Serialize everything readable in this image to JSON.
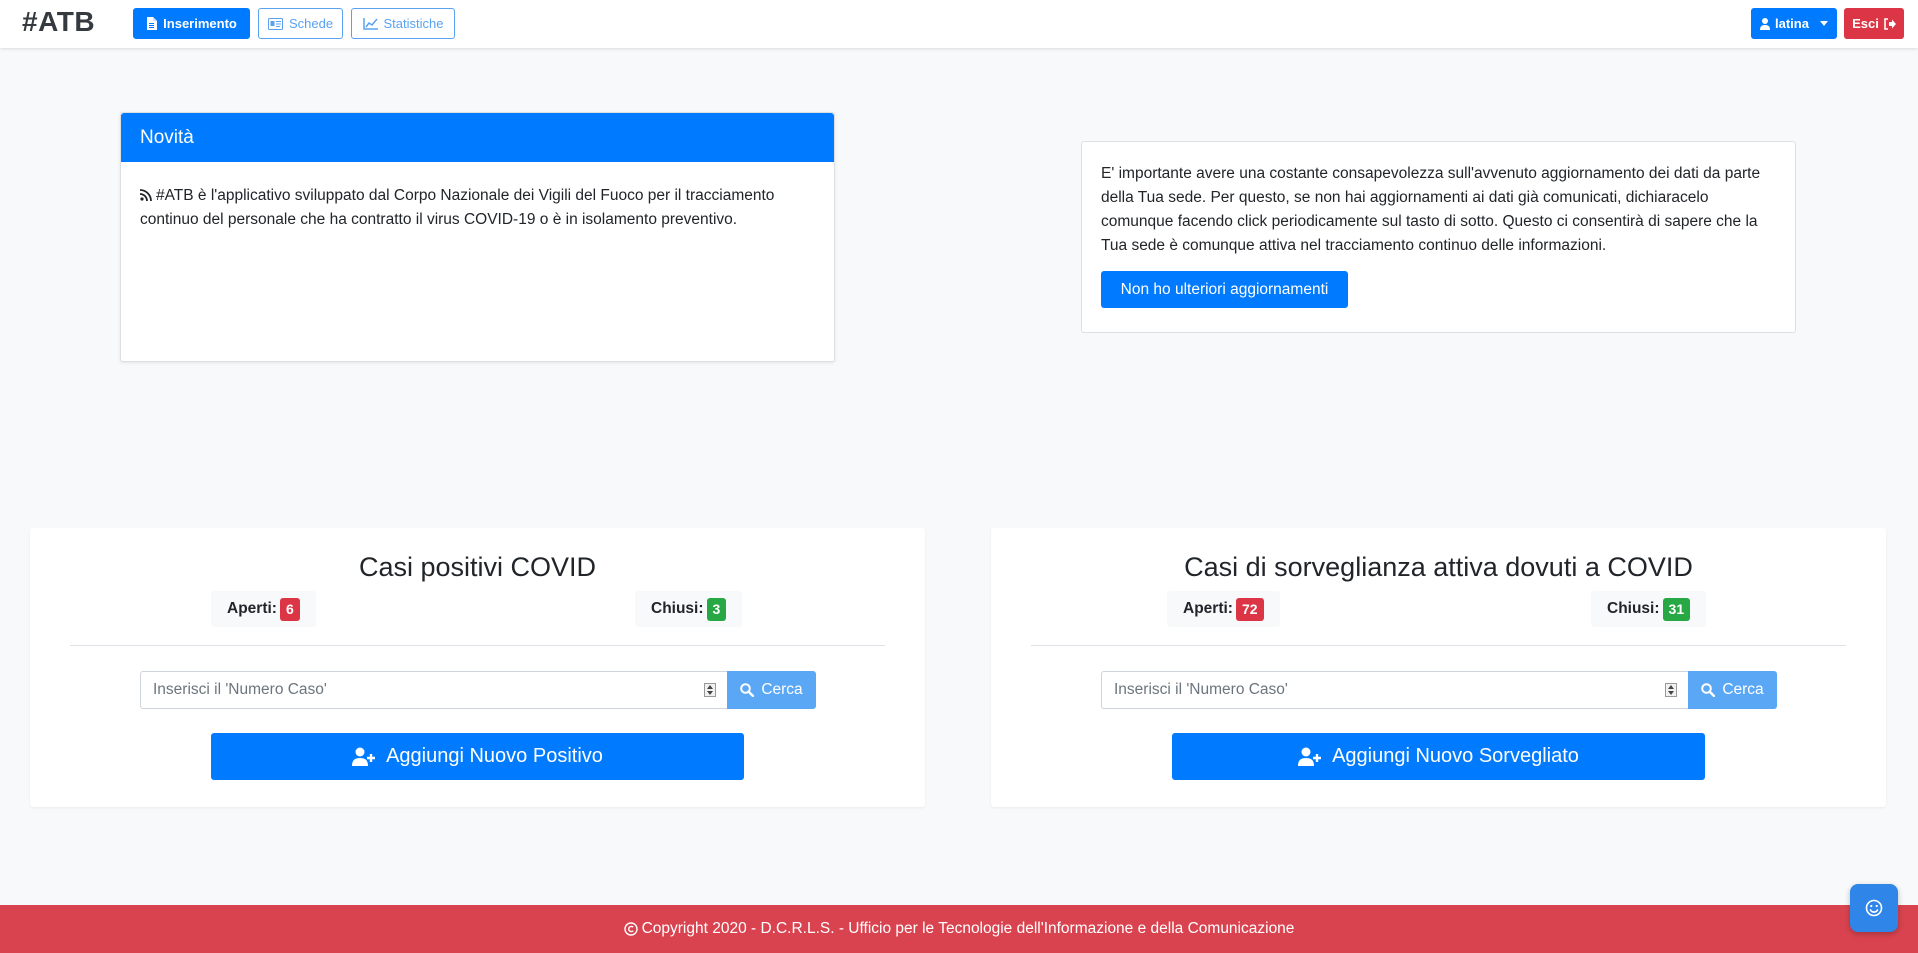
{
  "brand": "#ATB",
  "nav": {
    "tabs": [
      {
        "label": "Inserimento"
      },
      {
        "label": "Schede"
      },
      {
        "label": "Statistiche"
      }
    ],
    "user_label": "latina",
    "logout_label": "Esci"
  },
  "news": {
    "title": "Novità",
    "body": "#ATB è l'applicativo sviluppato dal Corpo Nazionale dei Vigili del Fuoco per il tracciamento continuo del personale che ha contratto il virus COVID-19 o è in isolamento preventivo."
  },
  "info": {
    "body": "E' importante avere una costante consapevolezza sull'avvenuto aggiornamento dei dati da parte della Tua sede. Per questo, se non hai aggiornamenti ai dati già comunicati, dichiaracelo comunque facendo click periodicamente sul tasto di sotto. Questo ci consentirà di sapere che la Tua sede è comunque attiva nel tracciamento continuo delle informazioni.",
    "button_label": "Non ho ulteriori aggiornamenti"
  },
  "positivi": {
    "title": "Casi positivi COVID",
    "open_label": "Aperti:",
    "open_count": "6",
    "closed_label": "Chiusi:",
    "closed_count": "3",
    "search_placeholder": "Inserisci il 'Numero Caso'",
    "search_label": "Cerca",
    "add_label": "Aggiungi Nuovo Positivo"
  },
  "sorveglianza": {
    "title": "Casi di sorveglianza attiva dovuti a COVID",
    "open_label": "Aperti:",
    "open_count": "72",
    "closed_label": "Chiusi:",
    "closed_count": "31",
    "search_placeholder": "Inserisci il 'Numero Caso'",
    "search_label": "Cerca",
    "add_label": "Aggiungi Nuovo Sorvegliato"
  },
  "footer": {
    "text": "Copyright 2020 - D.C.R.L.S. - Ufficio per le Tecnologie dell'Informazione e della Comunicazione"
  },
  "colors": {
    "primary": "#007bff",
    "danger": "#dc3545",
    "success": "#28a745",
    "footer": "#d9434f"
  }
}
